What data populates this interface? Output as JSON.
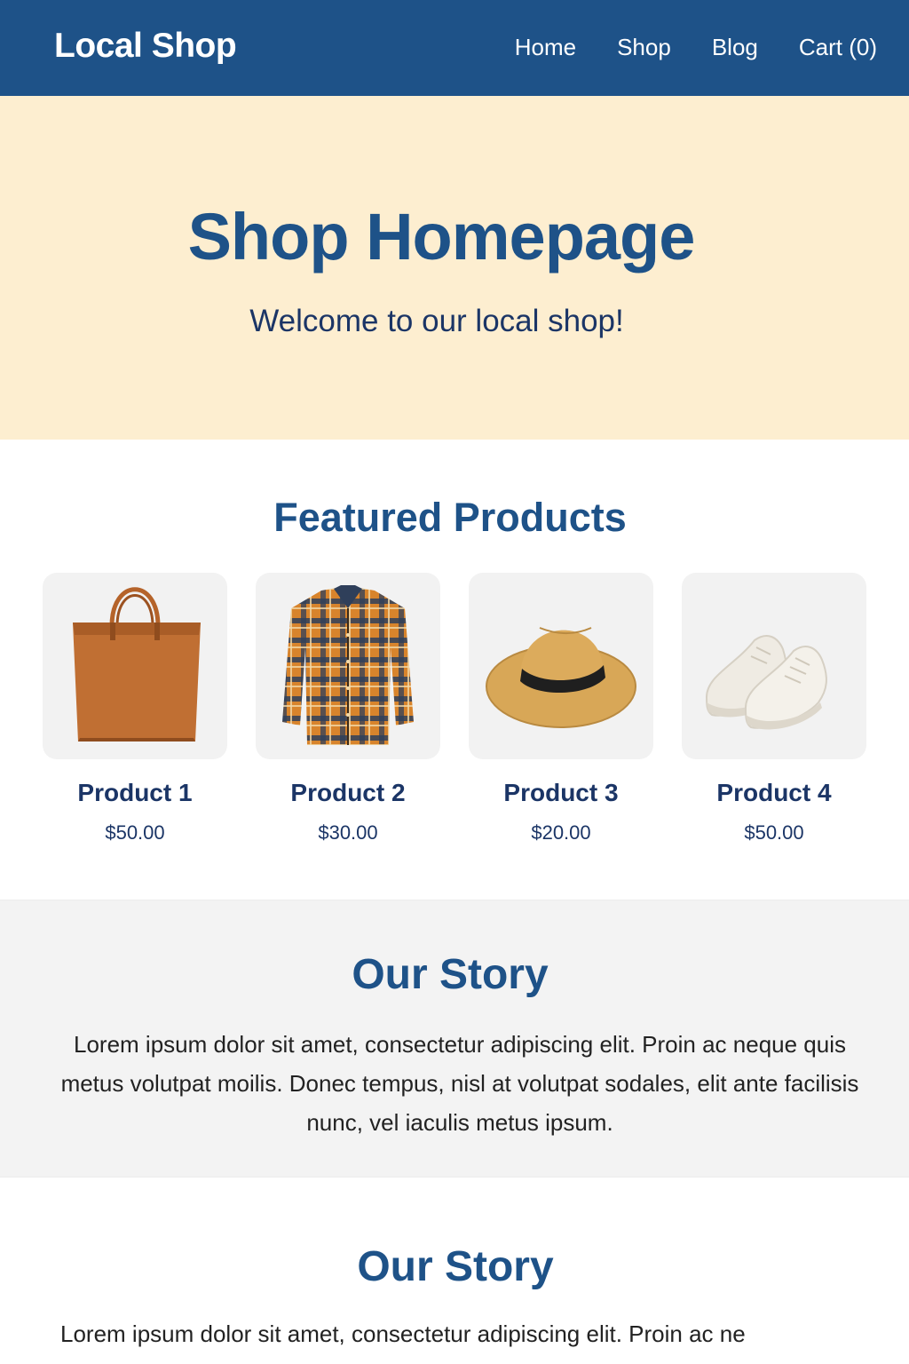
{
  "nav": {
    "brand": "Local Shop",
    "links": [
      {
        "label": "Home"
      },
      {
        "label": "Shop"
      },
      {
        "label": "Blog"
      },
      {
        "label": "Cart (0)"
      }
    ]
  },
  "hero": {
    "title": "Shop Homepage",
    "subtitle": "Welcome to our local shop!"
  },
  "featured": {
    "title": "Featured Products",
    "products": [
      {
        "name": "Product 1",
        "price": "$50.00",
        "image": "brown-leather-tote-bag"
      },
      {
        "name": "Product 2",
        "price": "$30.00",
        "image": "orange-plaid-flannel-shirt"
      },
      {
        "name": "Product 3",
        "price": "$20.00",
        "image": "straw-fedora-hat"
      },
      {
        "name": "Product 4",
        "price": "$50.00",
        "image": "white-sneakers"
      }
    ]
  },
  "story": {
    "title": "Our Story",
    "text": "Lorem ipsum dolor sit amet, consectetur adipiscing elit. Proin ac neque quis metus volutpat moilis. Donec tempus, nisl at volutpat sodales, elit ante facilisis nunc, vel iaculis metus ipsum."
  },
  "story2": {
    "title": "Our Story",
    "text": "Lorem ipsum dolor sit amet, consectetur adipiscing elit.  Proin ac ne"
  },
  "colors": {
    "nav_bg": "#1e5288",
    "hero_bg": "#fdeed0",
    "heading": "#1e5288",
    "story_bg": "#f3f3f3"
  }
}
